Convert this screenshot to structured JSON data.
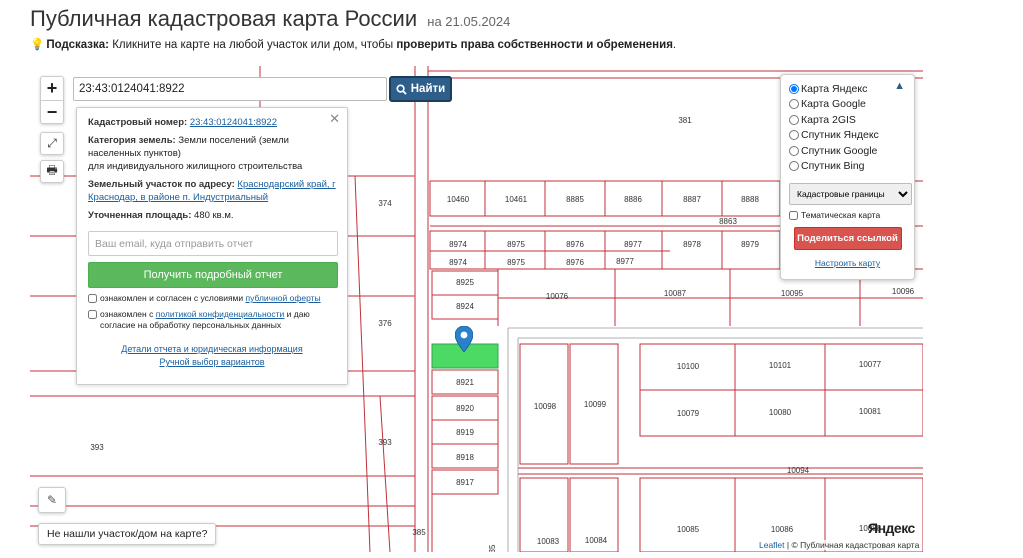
{
  "header": {
    "title": "Публичная кадастровая карта России",
    "date": "на 21.05.2024",
    "hint_label": "Подсказка:",
    "hint_text": "Кликните на карте на любой участок или дом, чтобы",
    "hint_bold": "проверить права собственности и обременения",
    "hint_end": "."
  },
  "map_controls": {
    "zoom_in": "+",
    "zoom_out": "−",
    "fullscreen_icon": "⤢",
    "print_icon": "🖶",
    "edit_icon": "✎"
  },
  "search": {
    "value": "23:43:0124041:8922",
    "button_label": "Найти"
  },
  "info": {
    "cadastral_label": "Кадастровый номер:",
    "cadastral_value": "23:43:0124041:8922",
    "category_label": "Категория земель:",
    "category_value": "Земли поселений (земли населенных пунктов)",
    "category_value2": "для индивидуального жилищного строительства",
    "address_label": "Земельный участок по адресу:",
    "address_value": "Краснодарский край, г Краснодар, в районе п. Индустриальный",
    "area_label": "Уточненная площадь:",
    "area_value": "480 кв.м.",
    "email_placeholder": "Ваш email, куда отправить отчет",
    "report_button": "Получить подробный отчет",
    "consent1_text": "ознакомлен и согласен с условиями",
    "consent1_link": "публичной оферты",
    "consent2_text": "ознакомлен с",
    "consent2_link": "политикой конфиденциальности",
    "consent2_text2": "и даю согласие на обработку персональных данных",
    "details_link": "Детали отчета и юридическая информация",
    "manual_link": "Ручной выбор вариантов",
    "close": "✕"
  },
  "layers": {
    "options": [
      "Карта Яндекс",
      "Карта Google",
      "Карта 2GIS",
      "Спутник Яндекс",
      "Спутник Google",
      "Спутник Bing"
    ],
    "selected": "Карта Яндекс",
    "select_value": "Кадастровые границы",
    "thematic_label": "Тематическая карта",
    "share_button": "Поделиться ссылкой",
    "setup_link": "Настроить карту",
    "collapse": "⌃"
  },
  "parcels": [
    {
      "id": "p381",
      "label": "381"
    },
    {
      "id": "p374",
      "label": "374"
    },
    {
      "id": "p376",
      "label": "376"
    },
    {
      "id": "p393a",
      "label": "393"
    },
    {
      "id": "p393b",
      "label": "393"
    },
    {
      "id": "p385",
      "label": "385"
    },
    {
      "id": "p10460",
      "label": "10460"
    },
    {
      "id": "p10461",
      "label": "10461"
    },
    {
      "id": "p8885",
      "label": "8885"
    },
    {
      "id": "p8886",
      "label": "8886"
    },
    {
      "id": "p8887",
      "label": "8887"
    },
    {
      "id": "p8888",
      "label": "8888"
    },
    {
      "id": "p8863",
      "label": "8863"
    },
    {
      "id": "p8974a",
      "label": "8974"
    },
    {
      "id": "p8975a",
      "label": "8975"
    },
    {
      "id": "p8976a",
      "label": "8976"
    },
    {
      "id": "p8977a",
      "label": "8977"
    },
    {
      "id": "p8978",
      "label": "8978"
    },
    {
      "id": "p8979",
      "label": "8979"
    },
    {
      "id": "p8974b",
      "label": "8974"
    },
    {
      "id": "p8975b",
      "label": "8975"
    },
    {
      "id": "p8976b",
      "label": "8976"
    },
    {
      "id": "p8977b",
      "label": "8977"
    },
    {
      "id": "p8925",
      "label": "8925"
    },
    {
      "id": "p8924",
      "label": "8924"
    },
    {
      "id": "p10076",
      "label": "10076"
    },
    {
      "id": "p10087",
      "label": "10087"
    },
    {
      "id": "p10095",
      "label": "10095"
    },
    {
      "id": "p10096",
      "label": "10096"
    },
    {
      "id": "p8921",
      "label": "8921"
    },
    {
      "id": "p8920",
      "label": "8920"
    },
    {
      "id": "p8919",
      "label": "8919"
    },
    {
      "id": "p8918",
      "label": "8918"
    },
    {
      "id": "p8917",
      "label": "8917"
    },
    {
      "id": "p10098",
      "label": "10098"
    },
    {
      "id": "p10099",
      "label": "10099"
    },
    {
      "id": "p10100",
      "label": "10100"
    },
    {
      "id": "p10101",
      "label": "10101"
    },
    {
      "id": "p10077",
      "label": "10077"
    },
    {
      "id": "p10079",
      "label": "10079"
    },
    {
      "id": "p10080",
      "label": "10080"
    },
    {
      "id": "p10081",
      "label": "10081"
    },
    {
      "id": "p10094",
      "label": "10094"
    },
    {
      "id": "p10083",
      "label": "10083"
    },
    {
      "id": "p10084",
      "label": "10084"
    },
    {
      "id": "p10085",
      "label": "10085"
    },
    {
      "id": "p10086",
      "label": "10086"
    },
    {
      "id": "p10088",
      "label": "10088"
    },
    {
      "id": "p35",
      "label": "35"
    }
  ],
  "footer": {
    "not_found": "Не нашли участок/дом на карте?",
    "yandex": "Яндекс",
    "leaflet": "Leaflet",
    "attribution": "| © Публичная кадастровая карта"
  },
  "colors": {
    "parcel_border": "#c0303a",
    "selected_parcel": "#4cd964",
    "search_button": "#2d5f8a",
    "report_button": "#5cb85c",
    "share_button": "#d9534f"
  }
}
